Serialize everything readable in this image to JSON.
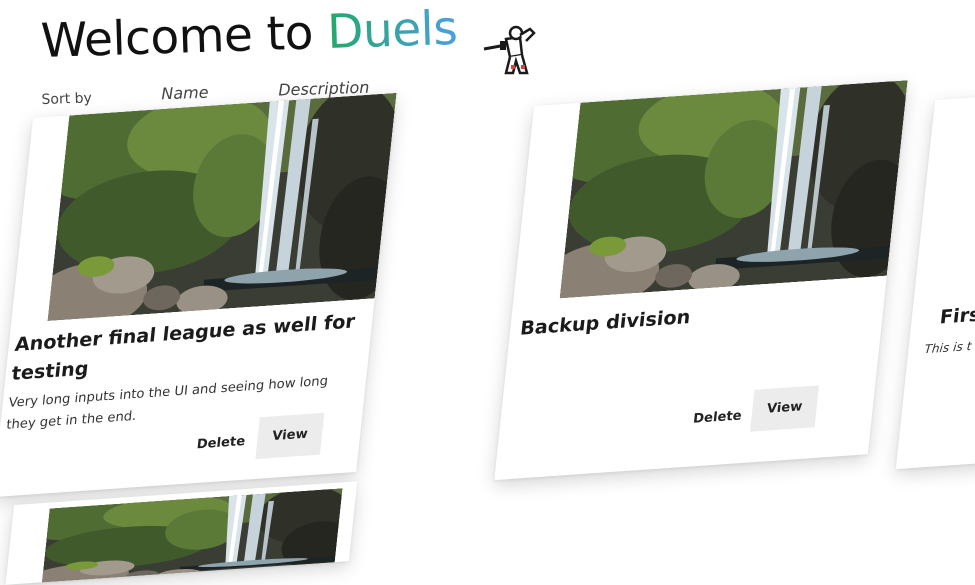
{
  "header": {
    "title_prefix": "Welcome to",
    "brand": "Duels",
    "mascot_icon": "fencer-mascot-icon",
    "brand_gradient": [
      "#23a86b",
      "#4b9fe0"
    ]
  },
  "sort": {
    "label": "Sort by",
    "options": [
      "Name",
      "Description"
    ]
  },
  "cards": [
    {
      "title": "Another final league as well for testing",
      "description": "Very long inputs into the UI and seeing how long they get in the end.",
      "delete_label": "Delete",
      "view_label": "View",
      "image": "waterfall-photo"
    },
    {
      "title": "Backup division",
      "description": "",
      "delete_label": "Delete",
      "view_label": "View",
      "image": "waterfall-photo"
    },
    {
      "title": "Firs",
      "description": "This is t schema",
      "image": "waterfall-photo"
    },
    {
      "image": "waterfall-photo"
    }
  ],
  "colors": {
    "view_button_bg": "#ececec",
    "card_bg": "#ffffff"
  }
}
